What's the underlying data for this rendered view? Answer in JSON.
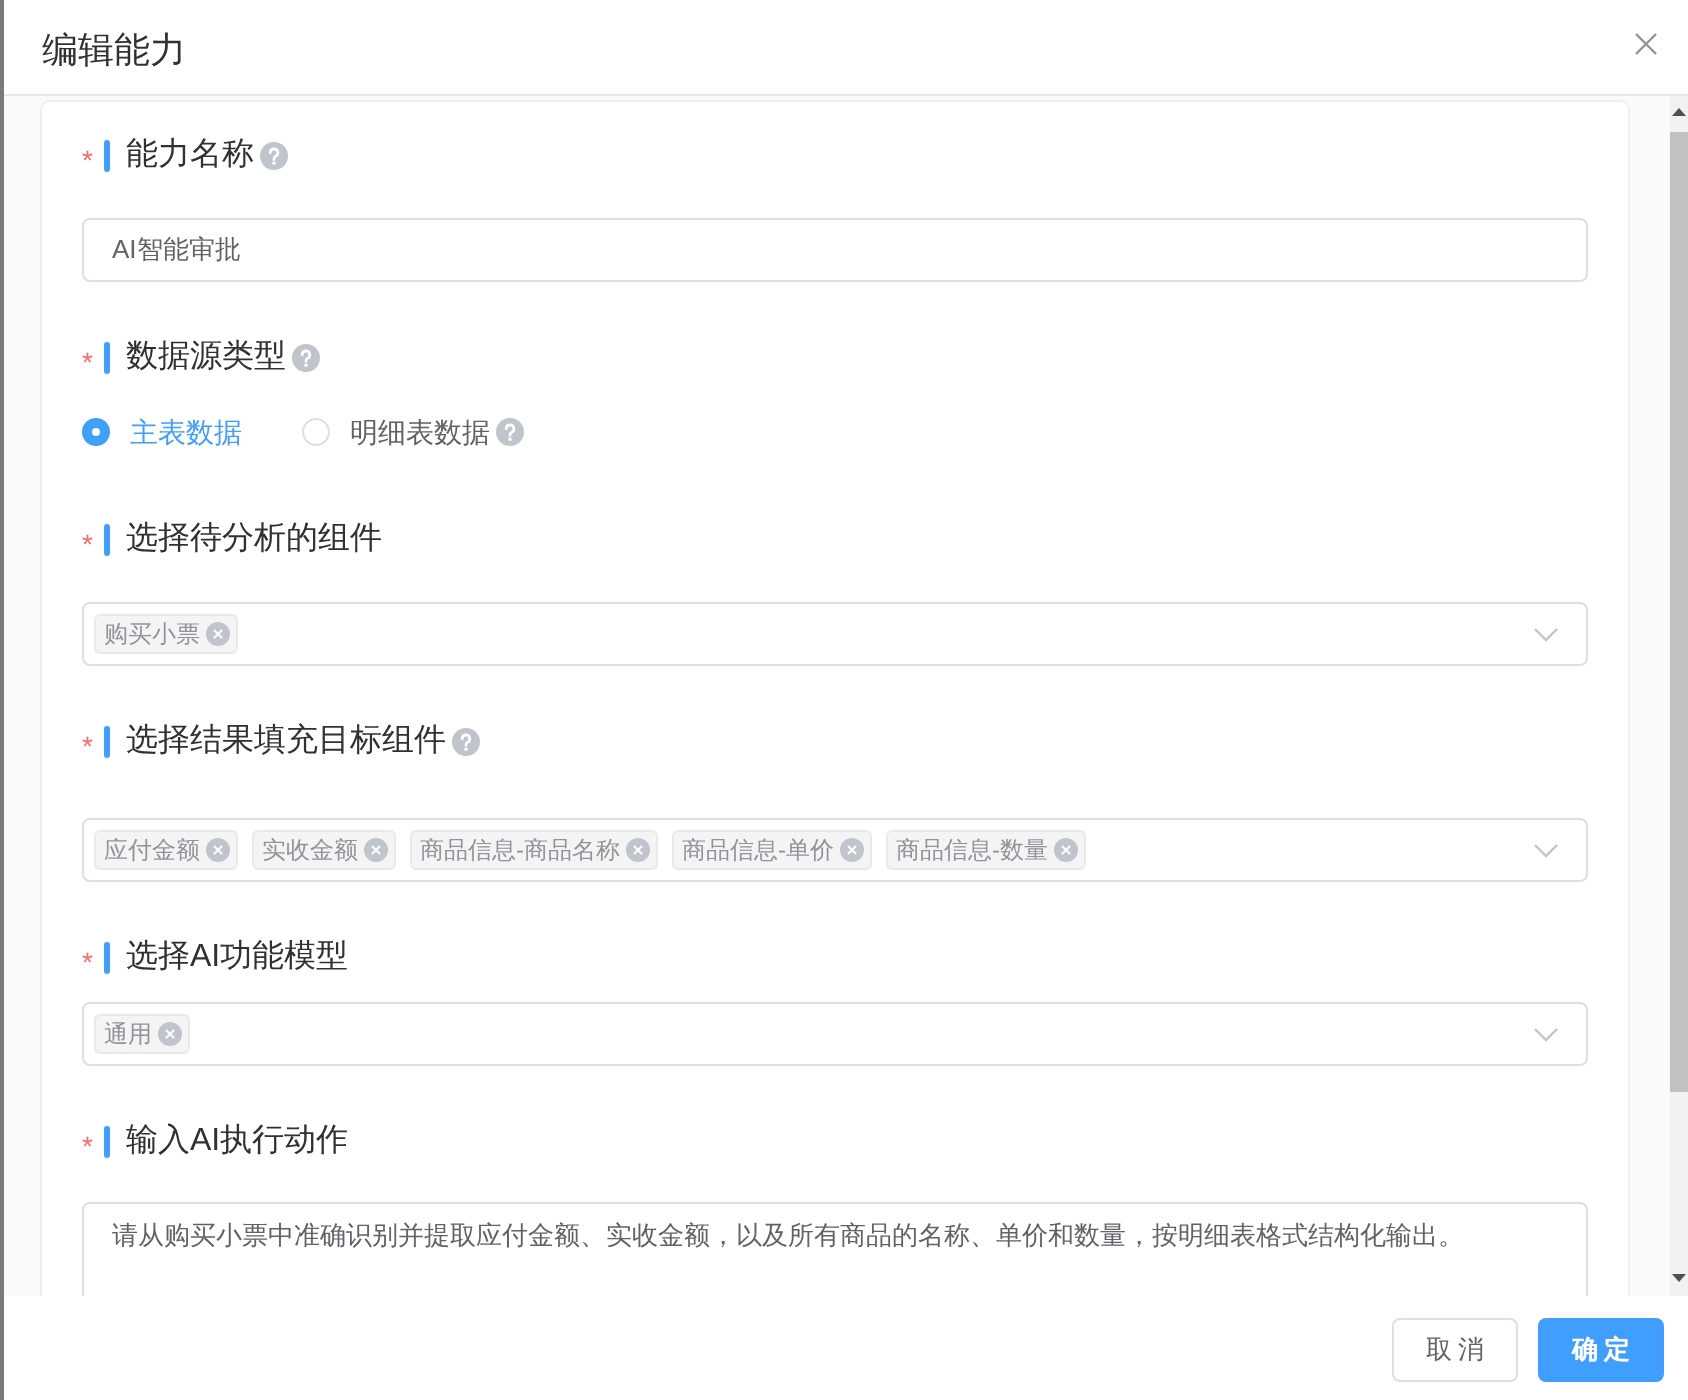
{
  "dialog": {
    "title": "编辑能力"
  },
  "fields": [
    {
      "kind": "input",
      "required_mark": "*",
      "label": "能力名称",
      "help": true,
      "value": "AI智能审批"
    },
    {
      "kind": "radio",
      "required_mark": "*",
      "label": "数据源类型",
      "help": true,
      "options": [
        {
          "label": "主表数据",
          "selected": true,
          "help": false
        },
        {
          "label": "明细表数据",
          "selected": false,
          "help": true
        }
      ]
    },
    {
      "kind": "select",
      "required_mark": "*",
      "label": "选择待分析的组件",
      "help": false,
      "tags": [
        "购买小票"
      ]
    },
    {
      "kind": "select",
      "required_mark": "*",
      "label": "选择结果填充目标组件",
      "help": true,
      "tags": [
        "应付金额",
        "实收金额",
        "商品信息-商品名称",
        "商品信息-单价",
        "商品信息-数量"
      ]
    },
    {
      "kind": "select",
      "required_mark": "*",
      "label": "选择AI功能模型",
      "help": false,
      "tags": [
        "通用"
      ]
    },
    {
      "kind": "textarea",
      "required_mark": "*",
      "label": "输入AI执行动作",
      "help": false,
      "value": "请从购买小票中准确识别并提取应付金额、实收金额，以及所有商品的名称、单价和数量，按明细表格式结构化输出。"
    }
  ],
  "footer": {
    "buttons": [
      {
        "label": "取消",
        "kind": "default"
      },
      {
        "label": "确定",
        "kind": "primary"
      }
    ]
  }
}
